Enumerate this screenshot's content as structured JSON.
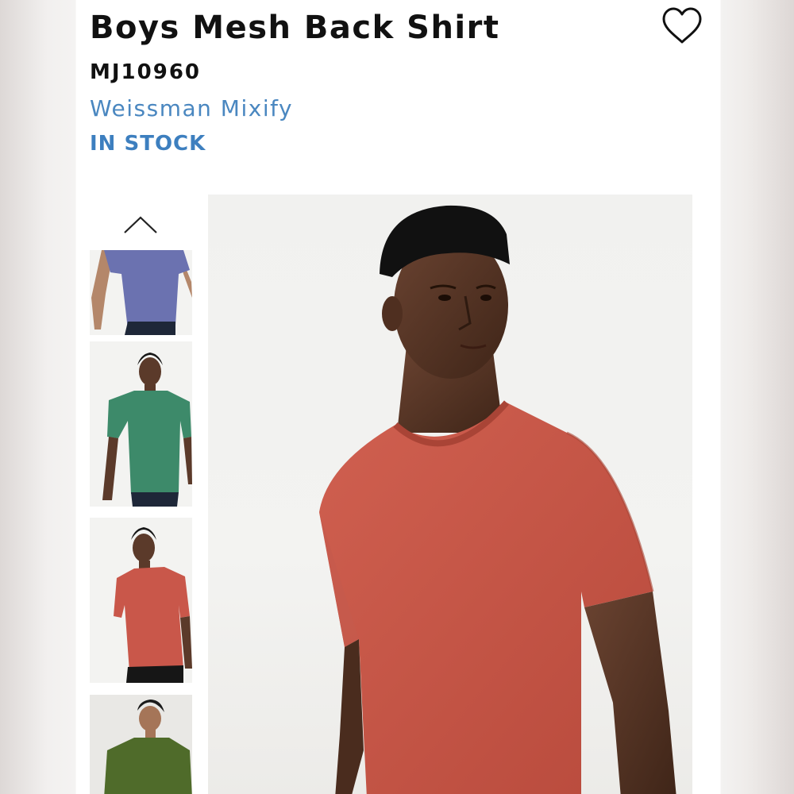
{
  "product": {
    "title": "Boys Mesh Back Shirt",
    "sku": "MJ10960",
    "brand": "Weissman Mixify",
    "stock_status": "IN STOCK"
  },
  "colors": {
    "brand_link": "#4a87c0",
    "stock": "#3d7fbf",
    "title": "#111111"
  },
  "icons": {
    "wishlist": "heart-outline-icon",
    "gallery_up": "chevron-up-icon"
  },
  "gallery": {
    "thumbnails": [
      {
        "shirt_color": "#6b72b0",
        "label": "blue shirt"
      },
      {
        "shirt_color": "#3d8a6a",
        "label": "green shirt"
      },
      {
        "shirt_color": "#c9574a",
        "label": "red shirt"
      },
      {
        "shirt_color": "#4f6b2a",
        "label": "olive shirt"
      }
    ],
    "main_shirt_color": "#c95848"
  }
}
